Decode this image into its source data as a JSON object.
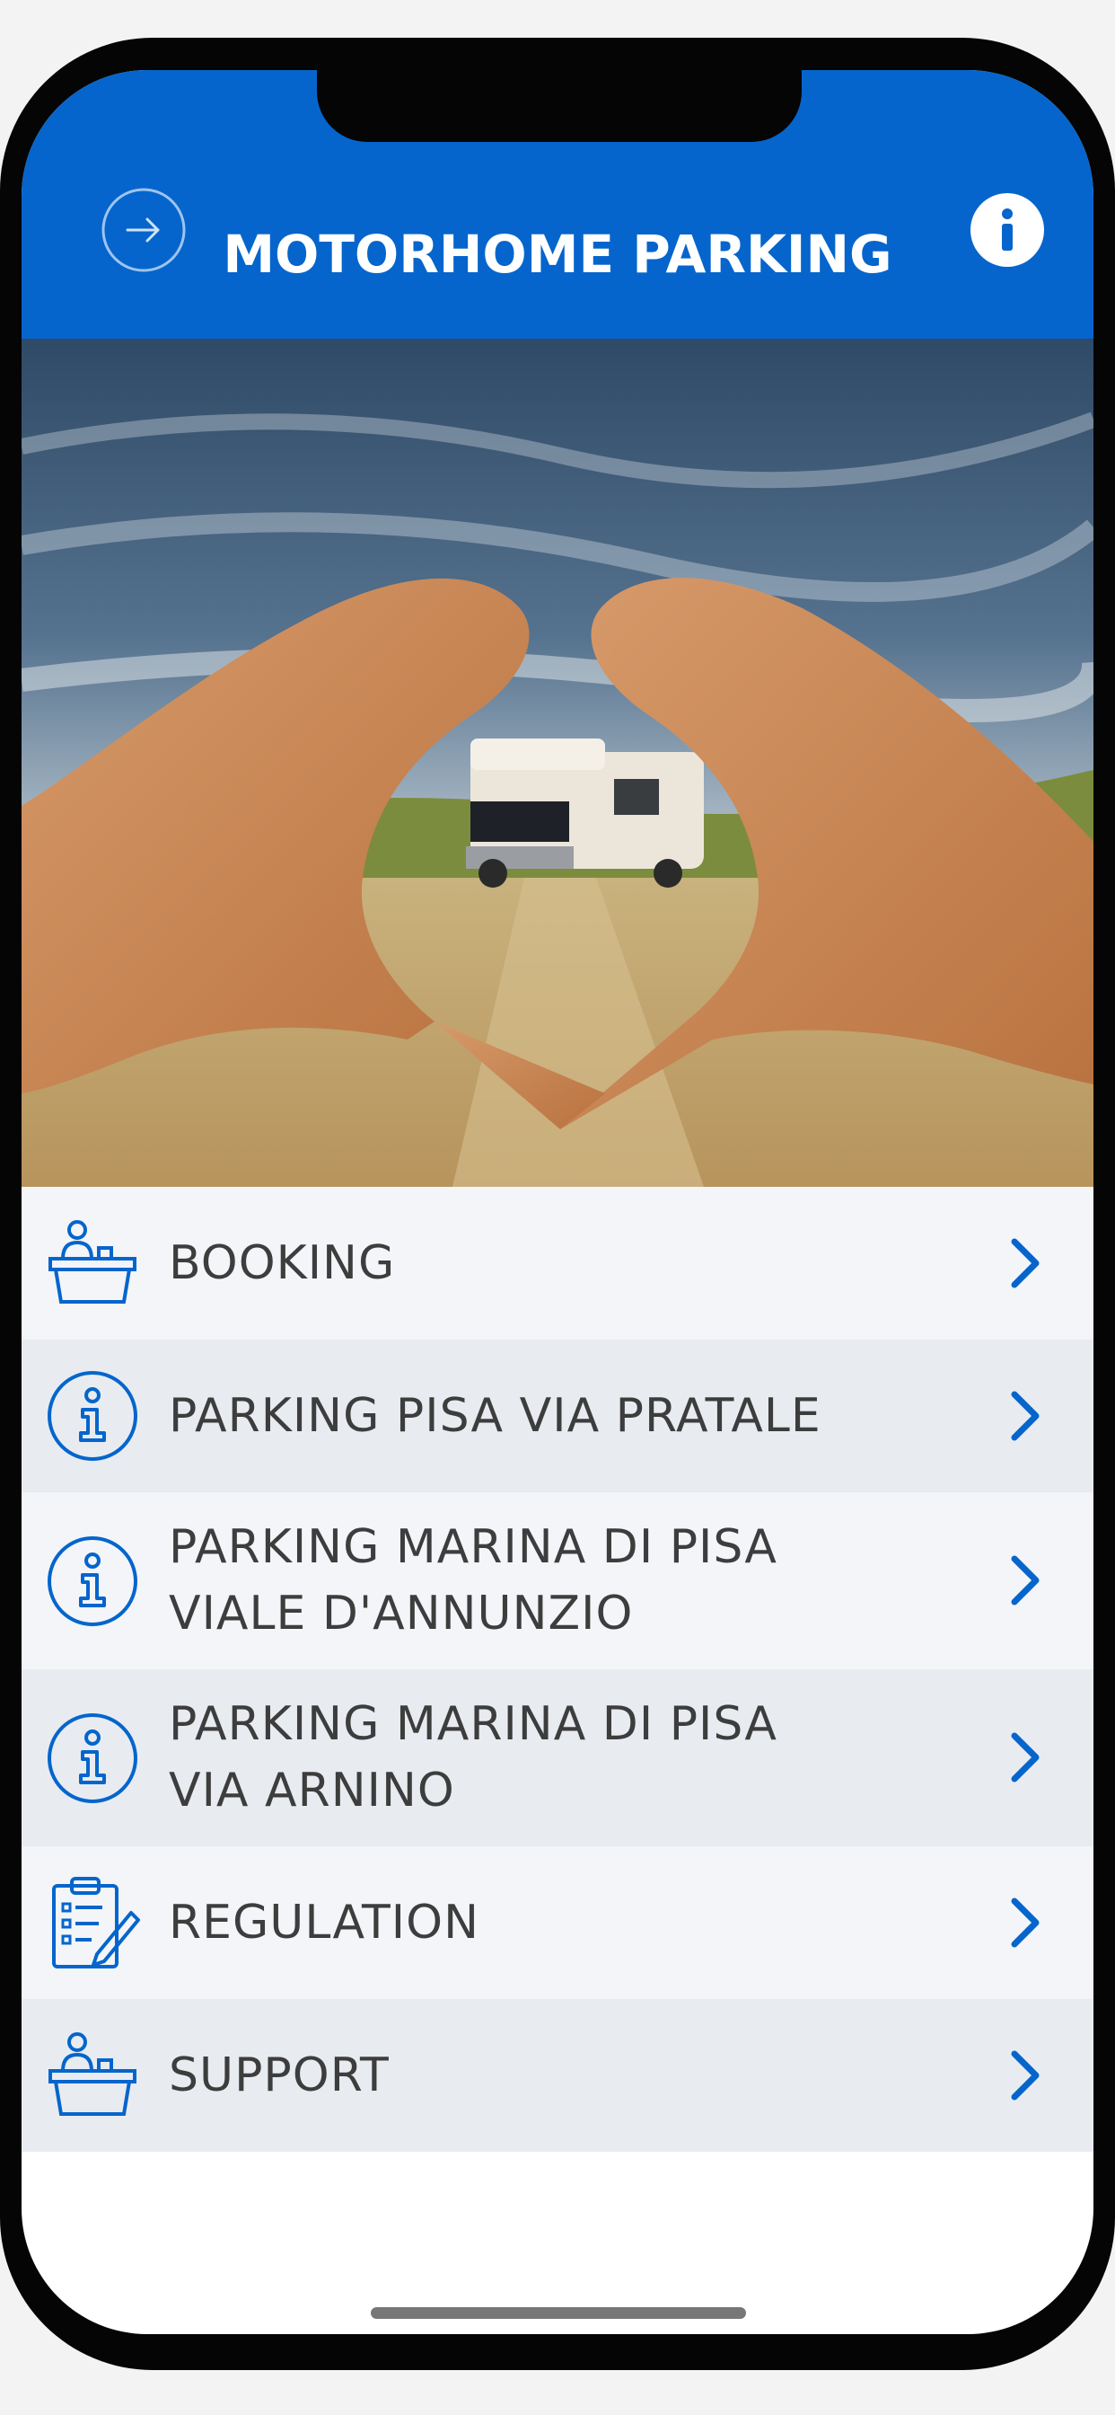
{
  "header": {
    "title": "MOTORHOME PARKING",
    "logout_icon": "arrow-right-circle-icon",
    "info_icon": "info-circle-icon",
    "background_color": "#0565cc"
  },
  "hero": {
    "description_icon": "heart-hands-motorhome-photo"
  },
  "menu": {
    "items": [
      {
        "label": "BOOKING",
        "icon": "reception-desk-icon"
      },
      {
        "label": "PARKING PISA VIA PRATALE",
        "icon": "info-circle-icon"
      },
      {
        "label_line1": "PARKING MARINA DI PISA",
        "label_line2": "VIALE D'ANNUNZIO",
        "icon": "info-circle-icon"
      },
      {
        "label_line1": "PARKING MARINA DI PISA",
        "label_line2": "VIA ARNINO",
        "icon": "info-circle-icon"
      },
      {
        "label": "REGULATION",
        "icon": "clipboard-pen-icon"
      },
      {
        "label": "SUPPORT",
        "icon": "reception-desk-icon"
      }
    ],
    "chevron_icon": "chevron-right-icon",
    "accent_color": "#0565cc"
  }
}
